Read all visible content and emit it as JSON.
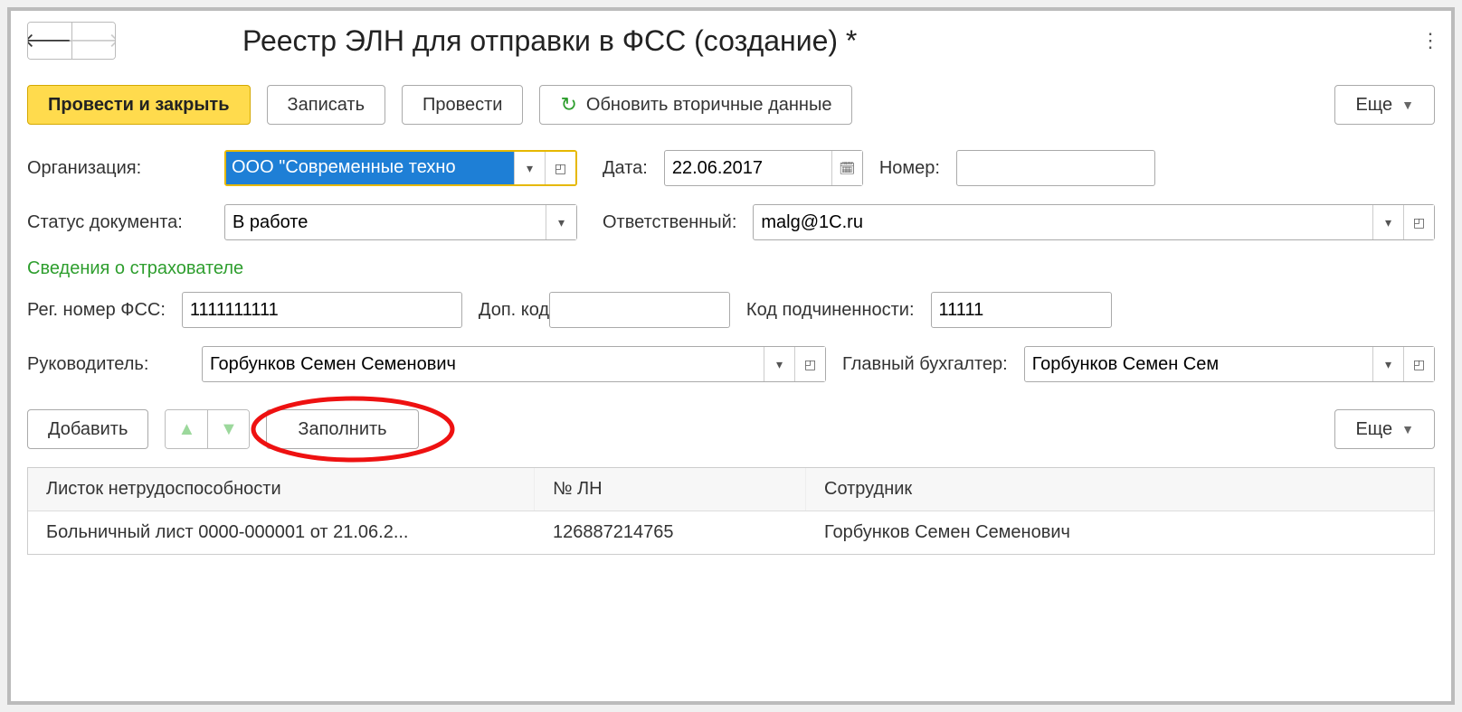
{
  "header": {
    "title": "Реестр ЭЛН для отправки в ФСС (создание) *"
  },
  "toolbar": {
    "post_close": "Провести и закрыть",
    "save": "Записать",
    "post": "Провести",
    "refresh": "Обновить вторичные данные",
    "more": "Еще"
  },
  "form": {
    "org_label": "Организация:",
    "org_value": "ООО \"Современные техно",
    "date_label": "Дата:",
    "date_value": "22.06.2017",
    "number_label": "Номер:",
    "number_value": "",
    "status_label": "Статус документа:",
    "status_value": "В работе",
    "responsible_label": "Ответственный:",
    "responsible_value": "malg@1C.ru"
  },
  "insurer": {
    "section_title": "Сведения о страхователе",
    "reg_label": "Рег. номер ФСС:",
    "reg_value": "1111111111",
    "addcode_label": "Доп. код:",
    "addcode_value": "",
    "subcode_label": "Код подчиненности:",
    "subcode_value": "11111",
    "head_label": "Руководитель:",
    "head_value": "Горбунков Семен Семенович",
    "chief_label": "Главный бухгалтер:",
    "chief_value": "Горбунков Семен Сем"
  },
  "list_toolbar": {
    "add": "Добавить",
    "fill": "Заполнить",
    "more": "Еще"
  },
  "table": {
    "columns": {
      "sheet": "Листок нетрудоспособности",
      "number": "№ ЛН",
      "employee": "Сотрудник"
    },
    "rows": [
      {
        "sheet": "Больничный лист 0000-000001 от 21.06.2...",
        "number": "126887214765",
        "employee": "Горбунков Семен Семенович"
      }
    ]
  }
}
